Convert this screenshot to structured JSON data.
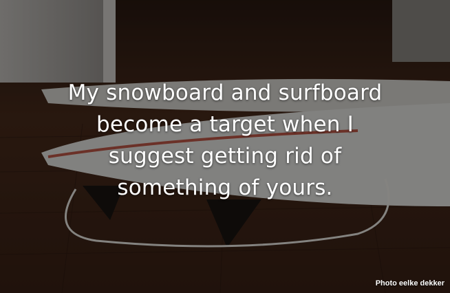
{
  "quote": {
    "lines": [
      "My snowboard and surfboard",
      "become a target when I",
      "suggest getting rid of",
      "something of yours."
    ]
  },
  "credit": "Photo eelke dekker",
  "colors": {
    "floor": "#3a2418",
    "board": "#e8e6e2",
    "overlay": "#000000",
    "text": "#ffffff"
  }
}
